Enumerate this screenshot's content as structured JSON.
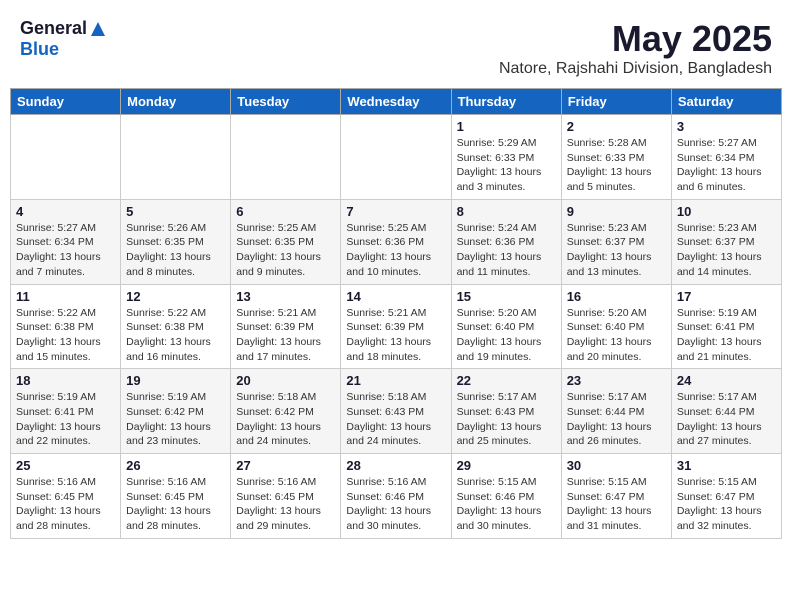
{
  "header": {
    "logo_general": "General",
    "logo_blue": "Blue",
    "month_title": "May 2025",
    "location": "Natore, Rajshahi Division, Bangladesh"
  },
  "days_of_week": [
    "Sunday",
    "Monday",
    "Tuesday",
    "Wednesday",
    "Thursday",
    "Friday",
    "Saturday"
  ],
  "weeks": [
    [
      {
        "day": "",
        "info": ""
      },
      {
        "day": "",
        "info": ""
      },
      {
        "day": "",
        "info": ""
      },
      {
        "day": "",
        "info": ""
      },
      {
        "day": "1",
        "info": "Sunrise: 5:29 AM\nSunset: 6:33 PM\nDaylight: 13 hours\nand 3 minutes."
      },
      {
        "day": "2",
        "info": "Sunrise: 5:28 AM\nSunset: 6:33 PM\nDaylight: 13 hours\nand 5 minutes."
      },
      {
        "day": "3",
        "info": "Sunrise: 5:27 AM\nSunset: 6:34 PM\nDaylight: 13 hours\nand 6 minutes."
      }
    ],
    [
      {
        "day": "4",
        "info": "Sunrise: 5:27 AM\nSunset: 6:34 PM\nDaylight: 13 hours\nand 7 minutes."
      },
      {
        "day": "5",
        "info": "Sunrise: 5:26 AM\nSunset: 6:35 PM\nDaylight: 13 hours\nand 8 minutes."
      },
      {
        "day": "6",
        "info": "Sunrise: 5:25 AM\nSunset: 6:35 PM\nDaylight: 13 hours\nand 9 minutes."
      },
      {
        "day": "7",
        "info": "Sunrise: 5:25 AM\nSunset: 6:36 PM\nDaylight: 13 hours\nand 10 minutes."
      },
      {
        "day": "8",
        "info": "Sunrise: 5:24 AM\nSunset: 6:36 PM\nDaylight: 13 hours\nand 11 minutes."
      },
      {
        "day": "9",
        "info": "Sunrise: 5:23 AM\nSunset: 6:37 PM\nDaylight: 13 hours\nand 13 minutes."
      },
      {
        "day": "10",
        "info": "Sunrise: 5:23 AM\nSunset: 6:37 PM\nDaylight: 13 hours\nand 14 minutes."
      }
    ],
    [
      {
        "day": "11",
        "info": "Sunrise: 5:22 AM\nSunset: 6:38 PM\nDaylight: 13 hours\nand 15 minutes."
      },
      {
        "day": "12",
        "info": "Sunrise: 5:22 AM\nSunset: 6:38 PM\nDaylight: 13 hours\nand 16 minutes."
      },
      {
        "day": "13",
        "info": "Sunrise: 5:21 AM\nSunset: 6:39 PM\nDaylight: 13 hours\nand 17 minutes."
      },
      {
        "day": "14",
        "info": "Sunrise: 5:21 AM\nSunset: 6:39 PM\nDaylight: 13 hours\nand 18 minutes."
      },
      {
        "day": "15",
        "info": "Sunrise: 5:20 AM\nSunset: 6:40 PM\nDaylight: 13 hours\nand 19 minutes."
      },
      {
        "day": "16",
        "info": "Sunrise: 5:20 AM\nSunset: 6:40 PM\nDaylight: 13 hours\nand 20 minutes."
      },
      {
        "day": "17",
        "info": "Sunrise: 5:19 AM\nSunset: 6:41 PM\nDaylight: 13 hours\nand 21 minutes."
      }
    ],
    [
      {
        "day": "18",
        "info": "Sunrise: 5:19 AM\nSunset: 6:41 PM\nDaylight: 13 hours\nand 22 minutes."
      },
      {
        "day": "19",
        "info": "Sunrise: 5:19 AM\nSunset: 6:42 PM\nDaylight: 13 hours\nand 23 minutes."
      },
      {
        "day": "20",
        "info": "Sunrise: 5:18 AM\nSunset: 6:42 PM\nDaylight: 13 hours\nand 24 minutes."
      },
      {
        "day": "21",
        "info": "Sunrise: 5:18 AM\nSunset: 6:43 PM\nDaylight: 13 hours\nand 24 minutes."
      },
      {
        "day": "22",
        "info": "Sunrise: 5:17 AM\nSunset: 6:43 PM\nDaylight: 13 hours\nand 25 minutes."
      },
      {
        "day": "23",
        "info": "Sunrise: 5:17 AM\nSunset: 6:44 PM\nDaylight: 13 hours\nand 26 minutes."
      },
      {
        "day": "24",
        "info": "Sunrise: 5:17 AM\nSunset: 6:44 PM\nDaylight: 13 hours\nand 27 minutes."
      }
    ],
    [
      {
        "day": "25",
        "info": "Sunrise: 5:16 AM\nSunset: 6:45 PM\nDaylight: 13 hours\nand 28 minutes."
      },
      {
        "day": "26",
        "info": "Sunrise: 5:16 AM\nSunset: 6:45 PM\nDaylight: 13 hours\nand 28 minutes."
      },
      {
        "day": "27",
        "info": "Sunrise: 5:16 AM\nSunset: 6:45 PM\nDaylight: 13 hours\nand 29 minutes."
      },
      {
        "day": "28",
        "info": "Sunrise: 5:16 AM\nSunset: 6:46 PM\nDaylight: 13 hours\nand 30 minutes."
      },
      {
        "day": "29",
        "info": "Sunrise: 5:15 AM\nSunset: 6:46 PM\nDaylight: 13 hours\nand 30 minutes."
      },
      {
        "day": "30",
        "info": "Sunrise: 5:15 AM\nSunset: 6:47 PM\nDaylight: 13 hours\nand 31 minutes."
      },
      {
        "day": "31",
        "info": "Sunrise: 5:15 AM\nSunset: 6:47 PM\nDaylight: 13 hours\nand 32 minutes."
      }
    ]
  ]
}
